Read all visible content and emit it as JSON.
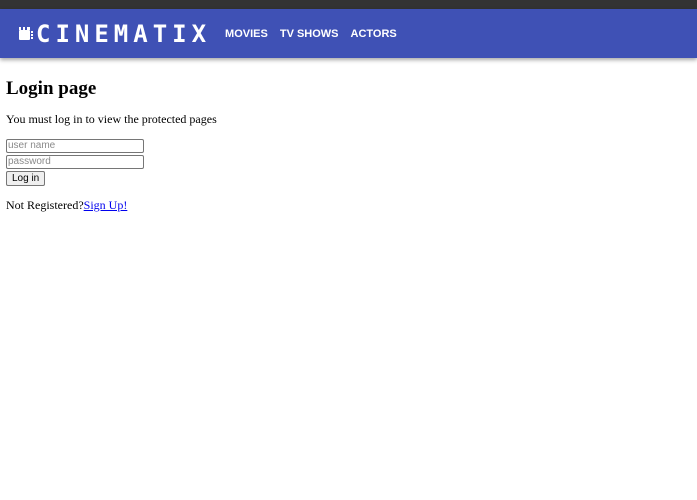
{
  "colors": {
    "navbar_bg": "#3f51b5",
    "top_strip": "#333333",
    "link": "#0000ee"
  },
  "brand": {
    "icon": "film-clapper-icon",
    "name": "CINEMATIX"
  },
  "nav": {
    "items": [
      {
        "label": "MOVIES"
      },
      {
        "label": "TV SHOWS"
      },
      {
        "label": "ACTORS"
      }
    ]
  },
  "main": {
    "title": "Login page",
    "intro": "You must log in to view the protected pages"
  },
  "form": {
    "username_placeholder": "user name",
    "username_value": "",
    "password_placeholder": "password",
    "password_value": "",
    "submit_label": "Log in"
  },
  "register": {
    "prompt": "Not Registered?",
    "link_label": "Sign Up!"
  }
}
